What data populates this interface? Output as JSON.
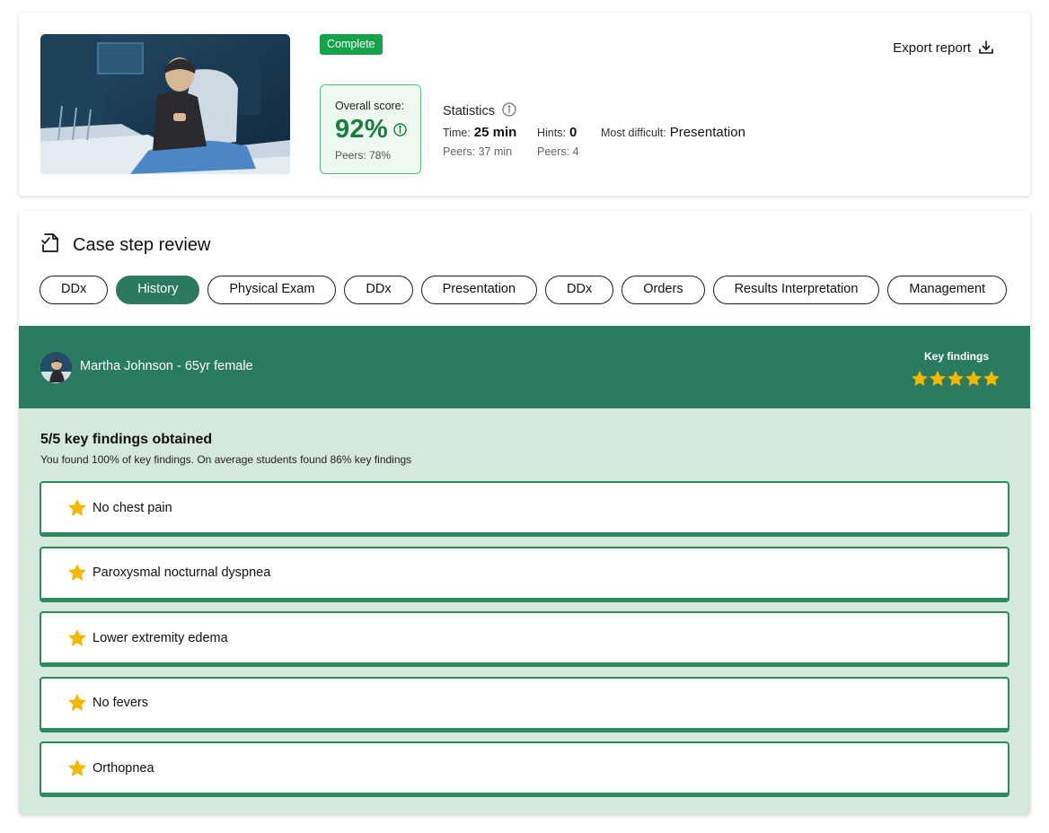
{
  "summary": {
    "status": "Complete",
    "export_label": "Export report",
    "score": {
      "label": "Overall score:",
      "value": "92%",
      "peers": "Peers: 78%"
    },
    "statistics": {
      "title": "Statistics",
      "time_label": "Time:",
      "time_value": "25 min",
      "time_peers": "Peers: 37 min",
      "hints_label": "Hints:",
      "hints_value": "0",
      "hints_peers": "Peers: 4",
      "difficult_label": "Most difficult:",
      "difficult_value": "Presentation"
    }
  },
  "review": {
    "title": "Case step review",
    "tabs": [
      {
        "label": "DDx"
      },
      {
        "label": "History",
        "active": true
      },
      {
        "label": "Physical Exam"
      },
      {
        "label": "DDx"
      },
      {
        "label": "Presentation"
      },
      {
        "label": "DDx"
      },
      {
        "label": "Orders"
      },
      {
        "label": "Results Interpretation"
      },
      {
        "label": "Management"
      }
    ],
    "patient": {
      "name": "Martha Johnson - 65yr female",
      "key_findings_label": "Key findings",
      "stars": 5
    },
    "findings": {
      "title": "5/5 key findings obtained",
      "subtitle": "You found 100% of key findings. On average students found 86% key findings",
      "items": [
        "No chest pain",
        "Paroxysmal nocturnal dyspnea",
        "Lower extremity edema",
        "No fevers",
        "Orthopnea"
      ]
    }
  },
  "colors": {
    "accent_green": "#2b7a62",
    "badge_green": "#15a34a",
    "score_green": "#16803a",
    "findings_bg": "#d5e8dc",
    "star": "#f5b800"
  }
}
